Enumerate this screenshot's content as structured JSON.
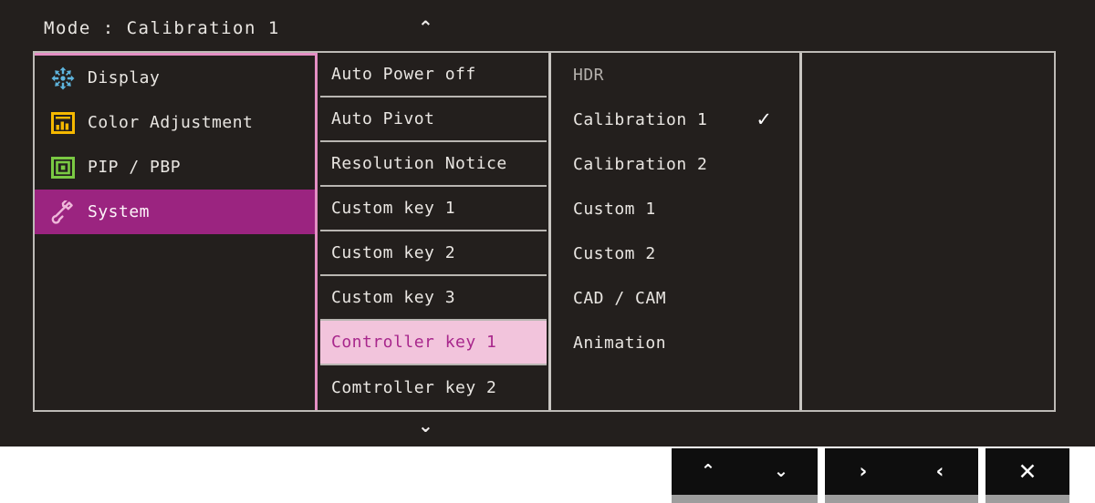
{
  "header": {
    "mode_label": "Mode : Calibration 1",
    "scroll_up_icon": "chevron-up",
    "scroll_up_glyph": "⌃",
    "scroll_down_icon": "chevron-down",
    "scroll_down_glyph": "⌄"
  },
  "colors": {
    "osd_background": "#231f1d",
    "selected_category": "#9b2480",
    "selected_setting_bg": "#f2c4dc",
    "selected_setting_text": "#a8278c",
    "accent_border": "#e48fc4",
    "divider": "#bdbab6",
    "text": "#e9e6e2",
    "icon_display": "#5eb4dd",
    "icon_color_adjustment": "#f5b800",
    "icon_pip_pbp": "#7ac943",
    "icon_system": "#efb8da"
  },
  "categories": [
    {
      "label": "Display",
      "icon": "brightness-arrows-icon",
      "selected": false
    },
    {
      "label": "Color Adjustment",
      "icon": "color-histogram-icon",
      "selected": false
    },
    {
      "label": "PIP / PBP",
      "icon": "picture-in-picture-icon",
      "selected": false
    },
    {
      "label": "System",
      "icon": "wrench-icon",
      "selected": true
    }
  ],
  "settings": [
    {
      "label": "Auto Power off",
      "selected": false
    },
    {
      "label": "Auto Pivot",
      "selected": false
    },
    {
      "label": "Resolution Notice",
      "selected": false
    },
    {
      "label": "Custom key 1",
      "selected": false
    },
    {
      "label": "Custom key 2",
      "selected": false
    },
    {
      "label": "Custom key 3",
      "selected": false
    },
    {
      "label": "Controller key 1",
      "selected": true
    },
    {
      "label": "Comtroller key 2",
      "selected": false
    }
  ],
  "values": [
    {
      "label": "HDR",
      "checked": false,
      "dim": true
    },
    {
      "label": "Calibration 1",
      "checked": true,
      "dim": false
    },
    {
      "label": "Calibration 2",
      "checked": false,
      "dim": false
    },
    {
      "label": "Custom 1",
      "checked": false,
      "dim": false
    },
    {
      "label": "Custom 2",
      "checked": false,
      "dim": false
    },
    {
      "label": "CAD / CAM",
      "checked": false,
      "dim": false
    },
    {
      "label": "Animation",
      "checked": false,
      "dim": false
    }
  ],
  "check_glyph": "✓",
  "hardware_buttons": [
    {
      "group": 1,
      "icon": "chevron-up-icon",
      "glyph": "⌃"
    },
    {
      "group": 1,
      "icon": "chevron-down-icon",
      "glyph": "⌄"
    },
    {
      "group": 2,
      "icon": "chevron-right-icon",
      "glyph": "›"
    },
    {
      "group": 2,
      "icon": "chevron-left-icon",
      "glyph": "‹"
    },
    {
      "group": 3,
      "icon": "close-x-icon",
      "glyph": "✕"
    }
  ]
}
